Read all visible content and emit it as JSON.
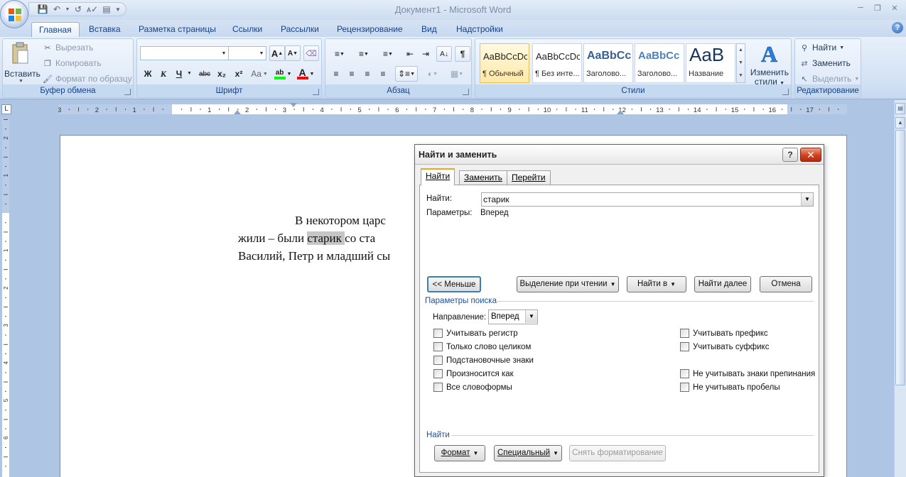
{
  "app": {
    "title": "Документ1 - Microsoft Word"
  },
  "qat": {
    "icons": [
      "save-icon",
      "undo-icon",
      "redo-icon",
      "spelling-icon",
      "print-preview-icon",
      "customize-icon"
    ]
  },
  "tabs": [
    {
      "label": "Главная",
      "active": true
    },
    {
      "label": "Вставка"
    },
    {
      "label": "Разметка страницы"
    },
    {
      "label": "Ссылки"
    },
    {
      "label": "Рассылки"
    },
    {
      "label": "Рецензирование"
    },
    {
      "label": "Вид"
    },
    {
      "label": "Надстройки"
    }
  ],
  "ribbon": {
    "clipboard": {
      "label": "Буфер обмена",
      "paste": "Вставить",
      "cut": "Вырезать",
      "copy": "Копировать",
      "format_painter": "Формат по образцу"
    },
    "font": {
      "label": "Шрифт",
      "font_name": "",
      "font_size": "",
      "bold": "Ж",
      "italic": "К",
      "underline": "Ч",
      "strike": "abc",
      "subscript": "x₂",
      "superscript": "x²",
      "change_case": "Aa",
      "grow": "A",
      "shrink": "A",
      "highlight_color": "#00ff00",
      "font_color": "#ff0000"
    },
    "paragraph": {
      "label": "Абзац"
    },
    "styles": {
      "label": "Стили",
      "items": [
        {
          "sample": "AaBbCcDc",
          "name": "¶ Обычный"
        },
        {
          "sample": "AaBbCcDc",
          "name": "¶ Без инте..."
        },
        {
          "sample": "AaBbCc",
          "name": "Заголово..."
        },
        {
          "sample": "AaBbCc",
          "name": "Заголово..."
        },
        {
          "sample": "AaB",
          "name": "Название"
        }
      ],
      "change_styles_line1": "Изменить",
      "change_styles_line2": "стили"
    },
    "editing": {
      "label": "Редактирование",
      "find": "Найти",
      "replace": "Заменить",
      "select": "Выделить"
    }
  },
  "ruler": {
    "corner": "L",
    "numbers": [
      "3",
      "2",
      "1",
      "1",
      "2",
      "3",
      "4",
      "5",
      "6",
      "7",
      "8",
      "9",
      "10",
      "11",
      "12",
      "13",
      "14",
      "15",
      "16",
      "17"
    ],
    "vnumbers": [
      "2",
      "1",
      "1",
      "2",
      "3",
      "4",
      "5",
      "6"
    ]
  },
  "document": {
    "line1": "В  некотором  царс",
    "line2_before": "жили  –  были  ",
    "line2_highlight": "старик ",
    "line2_after": " со  ста",
    "line3": "Василий, Петр и младший сы"
  },
  "dialog": {
    "title": "Найти и заменить",
    "help": "?",
    "close": "✕",
    "tabs": [
      "Найти",
      "Заменить",
      "Перейти"
    ],
    "find_label": "Найти:",
    "find_value": "старик",
    "params_label": "Параметры:",
    "params_value": "Вперед",
    "less_button": "<< Меньше",
    "reading_highlight_button": "Выделение при чтении",
    "find_in_button": "Найти в",
    "find_next_button": "Найти далее",
    "cancel_button": "Отмена",
    "search_options_head": "Параметры поиска",
    "direction_label": "Направление:",
    "direction_value": "Вперед",
    "left_options": [
      "Учитывать регистр",
      "Только слово целиком",
      "Подстановочные знаки",
      "Произносится как",
      "Все словоформы"
    ],
    "right_options": [
      "Учитывать префикс",
      "Учитывать суффикс",
      "Не учитывать знаки препинания",
      "Не учитывать пробелы"
    ],
    "find_section_head": "Найти",
    "format_button": "Формат",
    "special_button": "Специальный",
    "no_formatting_button": "Снять форматирование"
  }
}
